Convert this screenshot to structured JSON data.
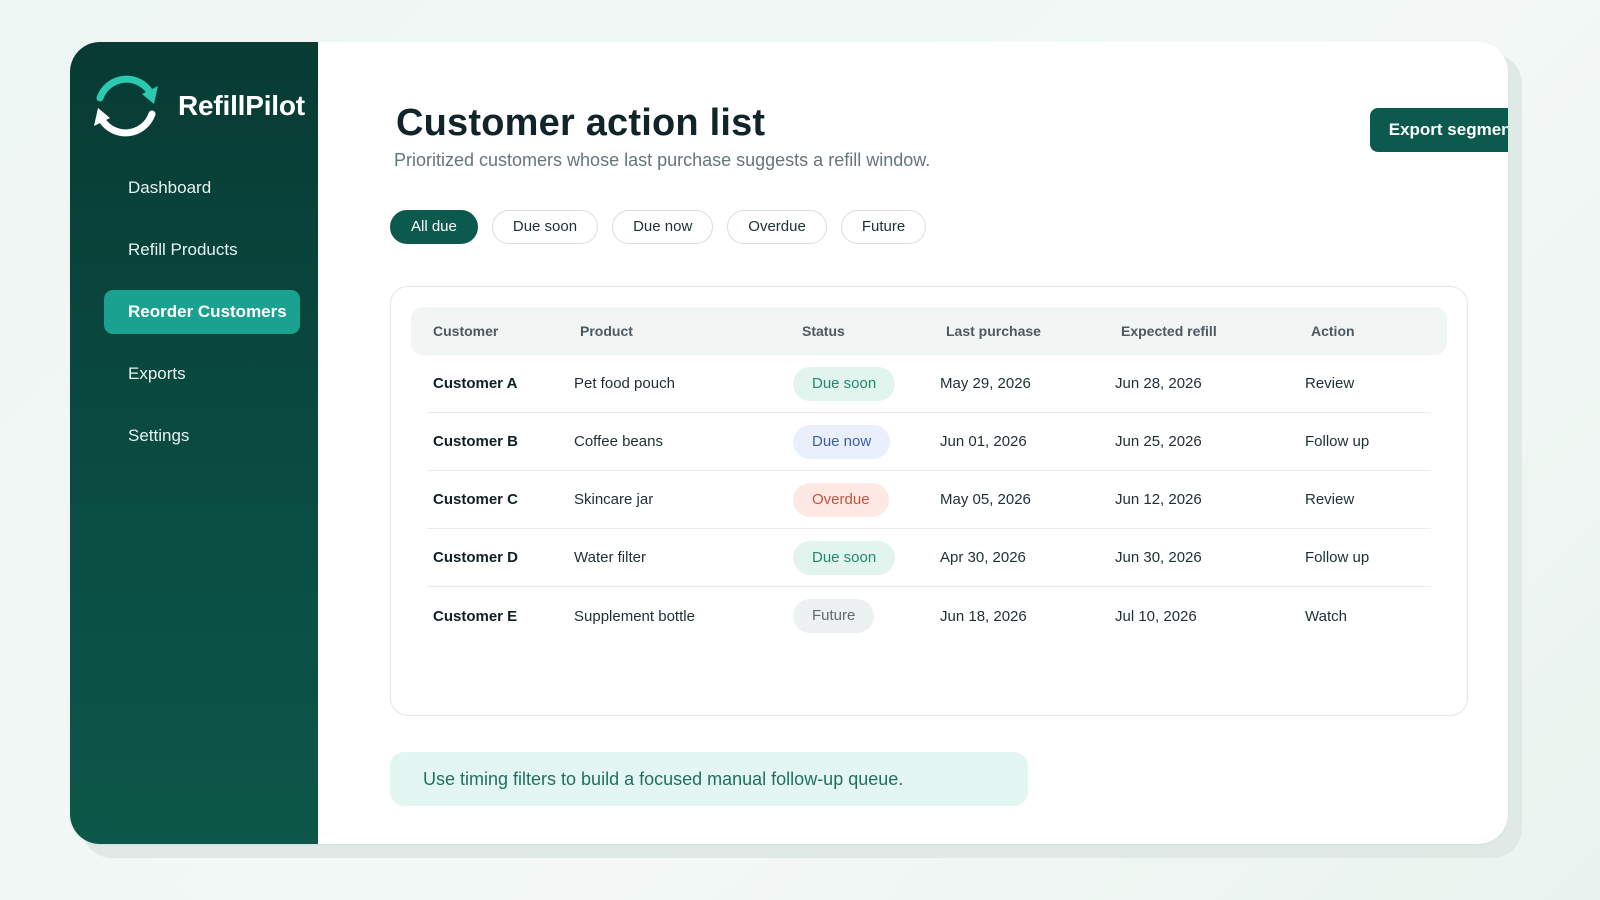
{
  "brand": {
    "name": "RefillPilot",
    "logo_icon": "refill-cycle-icon"
  },
  "sidebar": {
    "items": [
      {
        "label": "Dashboard",
        "active": false
      },
      {
        "label": "Refill Products",
        "active": false
      },
      {
        "label": "Reorder Customers",
        "active": true
      },
      {
        "label": "Exports",
        "active": false
      },
      {
        "label": "Settings",
        "active": false
      }
    ]
  },
  "header": {
    "title": "Customer action list",
    "subtitle": "Prioritized customers whose last purchase suggests a refill window.",
    "export_label": "Export segment"
  },
  "filters": [
    {
      "label": "All due",
      "active": true
    },
    {
      "label": "Due soon",
      "active": false
    },
    {
      "label": "Due now",
      "active": false
    },
    {
      "label": "Overdue",
      "active": false
    },
    {
      "label": "Future",
      "active": false
    }
  ],
  "table": {
    "columns": [
      "Customer",
      "Product",
      "Status",
      "Last purchase",
      "Expected refill",
      "Action"
    ],
    "rows": [
      {
        "customer": "Customer A",
        "product": "Pet food pouch",
        "status": "Due soon",
        "status_kind": "soon",
        "last_purchase": "May 29, 2026",
        "expected_refill": "Jun 28, 2026",
        "action": "Review"
      },
      {
        "customer": "Customer B",
        "product": "Coffee beans",
        "status": "Due now",
        "status_kind": "now",
        "last_purchase": "Jun 01, 2026",
        "expected_refill": "Jun 25, 2026",
        "action": "Follow up"
      },
      {
        "customer": "Customer C",
        "product": "Skincare jar",
        "status": "Overdue",
        "status_kind": "overdue",
        "last_purchase": "May 05, 2026",
        "expected_refill": "Jun 12, 2026",
        "action": "Review"
      },
      {
        "customer": "Customer D",
        "product": "Water filter",
        "status": "Due soon",
        "status_kind": "soon",
        "last_purchase": "Apr 30, 2026",
        "expected_refill": "Jun 30, 2026",
        "action": "Follow up"
      },
      {
        "customer": "Customer E",
        "product": "Supplement bottle",
        "status": "Future",
        "status_kind": "future",
        "last_purchase": "Jun 18, 2026",
        "expected_refill": "Jul 10, 2026",
        "action": "Watch"
      }
    ]
  },
  "hint": "Use timing filters to build a focused manual follow-up queue.",
  "colors": {
    "sidebar": "#0a4c42",
    "accent": "#1aa190",
    "primary_button": "#0c5a4d",
    "badge_soon": "#1f8a70",
    "badge_now": "#3a5fa8",
    "badge_overdue": "#c0543f",
    "badge_future": "#5e6b70"
  }
}
